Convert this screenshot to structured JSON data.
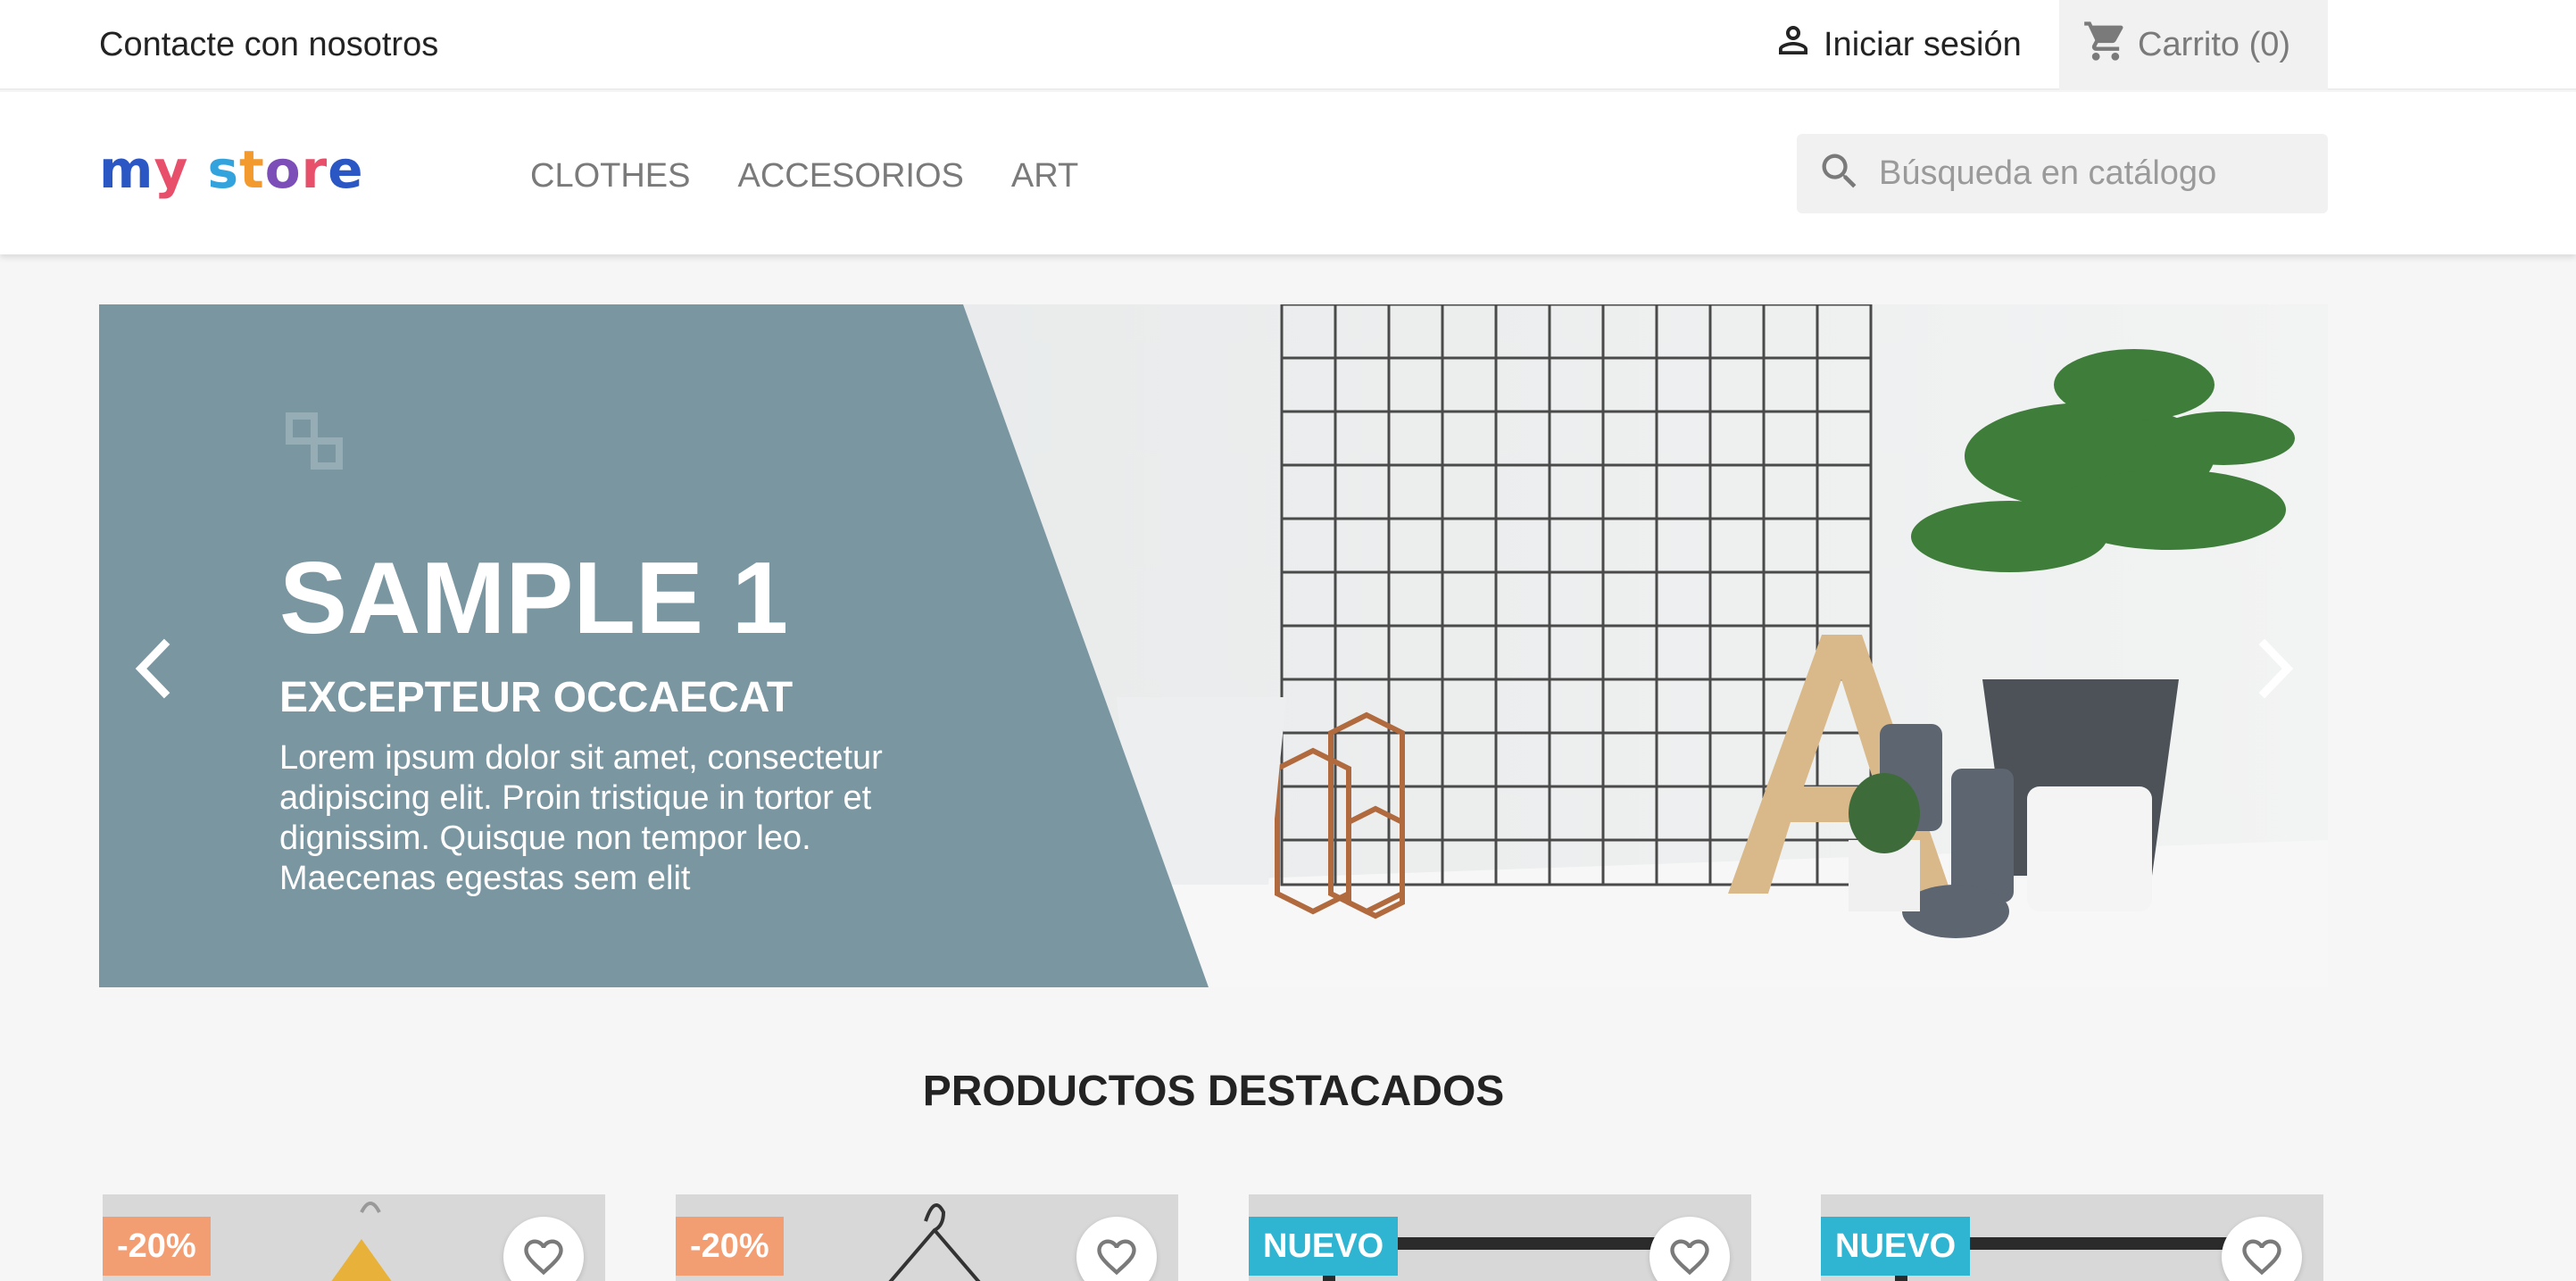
{
  "topbar": {
    "contact": "Contacte con nosotros",
    "login": "Iniciar sesión",
    "cart": "Carrito (0)"
  },
  "header": {
    "logo_text": [
      "m",
      "y",
      " ",
      "s",
      "t",
      "o",
      "r",
      "e"
    ],
    "nav": [
      "CLOTHES",
      "ACCESORIOS",
      "ART"
    ],
    "search_placeholder": "Búsqueda en catálogo"
  },
  "slider": {
    "title": "SAMPLE 1",
    "subtitle": "EXCEPTEUR OCCAECAT",
    "body": "Lorem ipsum dolor sit amet, consectetur adipiscing elit. Proin tristique in tortor et dignissim. Quisque non tempor leo. Maecenas egestas sem elit"
  },
  "featured": {
    "title": "PRODUCTOS DESTACADOS",
    "products": [
      {
        "badge": "-20%",
        "badge_type": "discount"
      },
      {
        "badge": "-20%",
        "badge_type": "discount"
      },
      {
        "badge": "NUEVO",
        "badge_type": "new"
      },
      {
        "badge": "NUEVO",
        "badge_type": "new"
      }
    ]
  },
  "colors": {
    "accent": "#2fb5d2",
    "discount": "#f39d72",
    "slide_panel": "#7a96a1"
  }
}
